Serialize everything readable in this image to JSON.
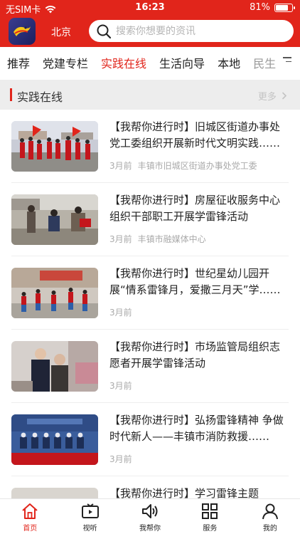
{
  "status": {
    "carrier": "无SIM卡",
    "time": "16:23",
    "battery_text": "81%",
    "battery_level": 0.81
  },
  "header": {
    "city": "北京",
    "search_placeholder": "搜索你想要的资讯"
  },
  "tabs": [
    {
      "label": "推荐"
    },
    {
      "label": "党建专栏"
    },
    {
      "label": "实践在线",
      "active": true
    },
    {
      "label": "生活向导"
    },
    {
      "label": "本地"
    },
    {
      "label": "民生"
    }
  ],
  "section": {
    "title": "实践在线",
    "more_label": "更多"
  },
  "articles": [
    {
      "title": "【我帮你进行时】旧城区街道办事处党工委组织开展新时代文明实践……",
      "time": "3月前",
      "source": "丰镇市旧城区街道办事处党工委",
      "thumb_icon": "parade-photo"
    },
    {
      "title": "【我帮你进行时】房屋征收服务中心组织干部职工开展学雷锋活动",
      "time": "3月前",
      "source": "丰镇市融媒体中心",
      "thumb_icon": "haircut-photo"
    },
    {
      "title": "【我帮你进行时】世纪星幼儿园开展“情系雷锋月，爱撒三月天”学……",
      "time": "3月前",
      "source": "",
      "thumb_icon": "kids-dance-photo"
    },
    {
      "title": "【我帮你进行时】市场监管局组织志愿者开展学雷锋活动",
      "time": "3月前",
      "source": "",
      "thumb_icon": "visit-elder-photo"
    },
    {
      "title": "【我帮你进行时】弘扬雷锋精神 争做时代新人——丰镇市消防救援……",
      "time": "3月前",
      "source": "",
      "thumb_icon": "fire-brigade-photo"
    },
    {
      "title": "【我帮你进行时】学习雷锋主题",
      "time": "",
      "source": "",
      "thumb_icon": "partial-photo"
    }
  ],
  "tabbar": [
    {
      "label": "首页",
      "icon": "home-icon",
      "active": true
    },
    {
      "label": "视听",
      "icon": "tv-icon"
    },
    {
      "label": "我帮你",
      "icon": "speaker-icon"
    },
    {
      "label": "服务",
      "icon": "grid-icon"
    },
    {
      "label": "我的",
      "icon": "user-icon"
    }
  ],
  "colors": {
    "brand": "#e1251b",
    "section_bg": "#ededed"
  }
}
